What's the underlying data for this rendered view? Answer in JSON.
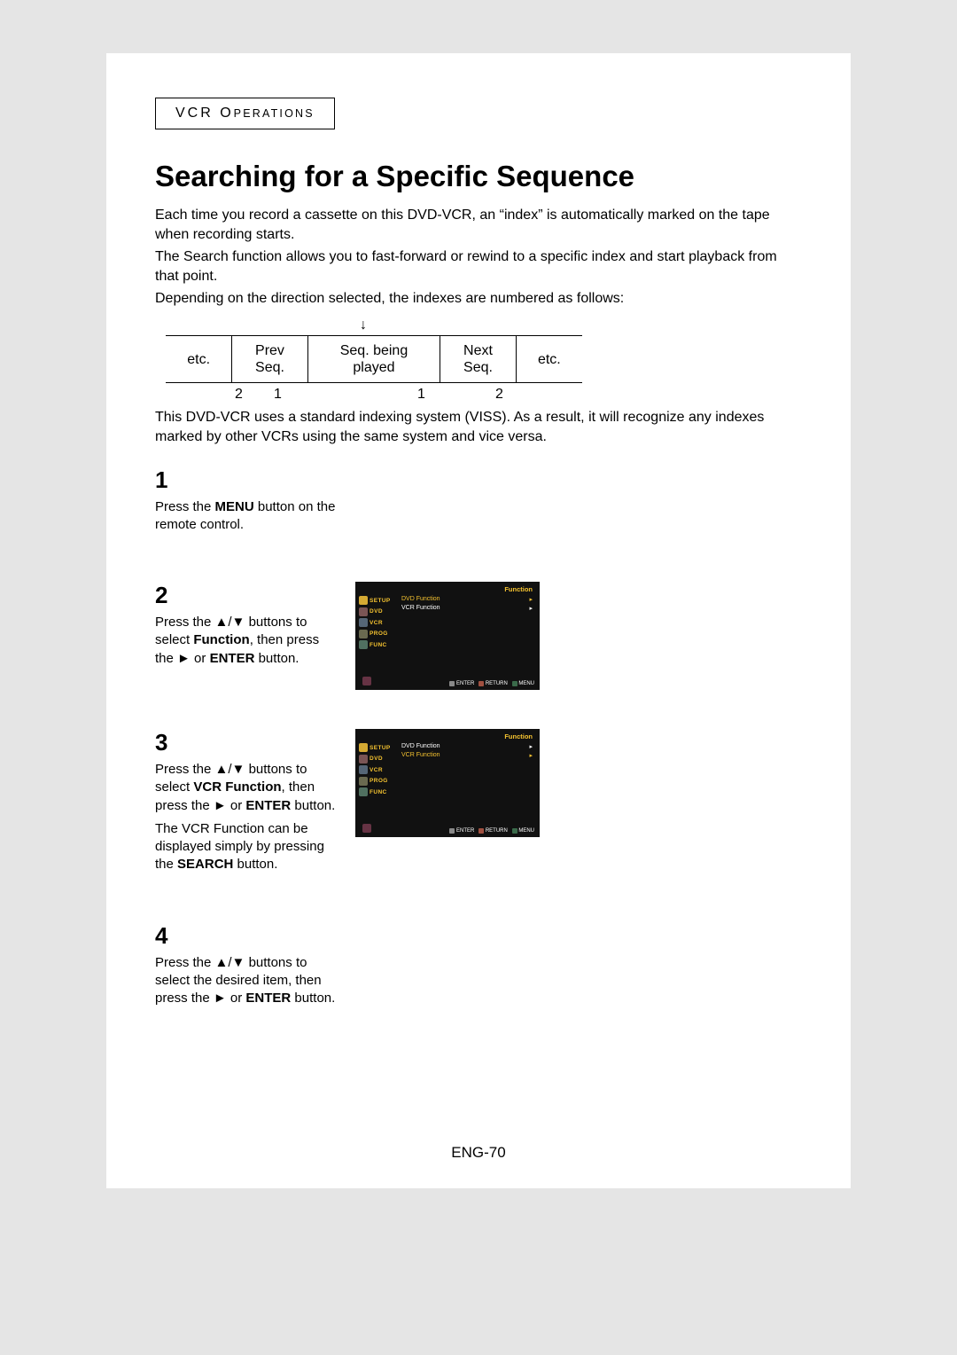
{
  "section_label": "VCR Oᴘᴇʀᴀᴛɪᴏɴs",
  "section_label_plain": "VCR OPERATIONS",
  "title": "Searching for a Specific Sequence",
  "intro": {
    "p1": "Each time you record a cassette on this DVD-VCR, an “index” is automatically marked on the tape when recording starts.",
    "p2": "The Search function allows you to fast-forward or rewind to a specific index and start playback from that point.",
    "p3": "Depending on the direction selected, the indexes are numbered as follows:"
  },
  "arrow": "↓",
  "seq_table": {
    "c1": "etc.",
    "c2a": "Prev",
    "c2b": "Seq.",
    "c3a": "Seq. being",
    "c3b": "played",
    "c4a": "Next",
    "c4b": "Seq.",
    "c5": "etc."
  },
  "seq_numbers": {
    "n1": "2",
    "n2": "1",
    "n3": "1",
    "n4": "2"
  },
  "post_table": "This DVD-VCR uses a standard indexing system (VISS). As a result, it will recognize any indexes marked by other VCRs using the same system and vice versa.",
  "steps": {
    "s1": {
      "num": "1",
      "text_before": "Press the ",
      "bold1": "MENU",
      "text_after": " button on the remote control."
    },
    "s2": {
      "num": "2",
      "t1": "Press the ",
      "arrows": "▲/▼",
      "t2": " buttons to select ",
      "bold1": "Function",
      "t3": ", then press the ",
      "play": "►",
      "t4": " or ",
      "bold2": "ENTER",
      "t5": " button."
    },
    "s3": {
      "num": "3",
      "t1": "Press the ",
      "arrows": "▲/▼",
      "t2": " buttons to select ",
      "bold1": "VCR Function",
      "t3": ", then press the ",
      "play": "►",
      "t4": " or ",
      "bold2": "ENTER",
      "t5": " button.",
      "p2a": "The VCR Function can be displayed simply by pressing the ",
      "p2bold": "SEARCH",
      "p2b": " button."
    },
    "s4": {
      "num": "4",
      "t1": "Press the ",
      "arrows": "▲/▼",
      "t2": " buttons to select the desired item, then press the ",
      "play": "►",
      "t3": " or ",
      "bold1": "ENTER",
      "t4": " button."
    }
  },
  "osd": {
    "header": "Function",
    "side": {
      "setup": "SETUP",
      "dvd": "DVD",
      "vcr": "VCR",
      "prog": "PROG",
      "func": "FUNC"
    },
    "menu": {
      "dvd": "DVD Function",
      "vcr": "VCR Function"
    },
    "arrow": "▸",
    "footer": {
      "enter": "ENTER",
      "return": "RETURN",
      "menu": "MENU"
    }
  },
  "page_number": "ENG-70"
}
